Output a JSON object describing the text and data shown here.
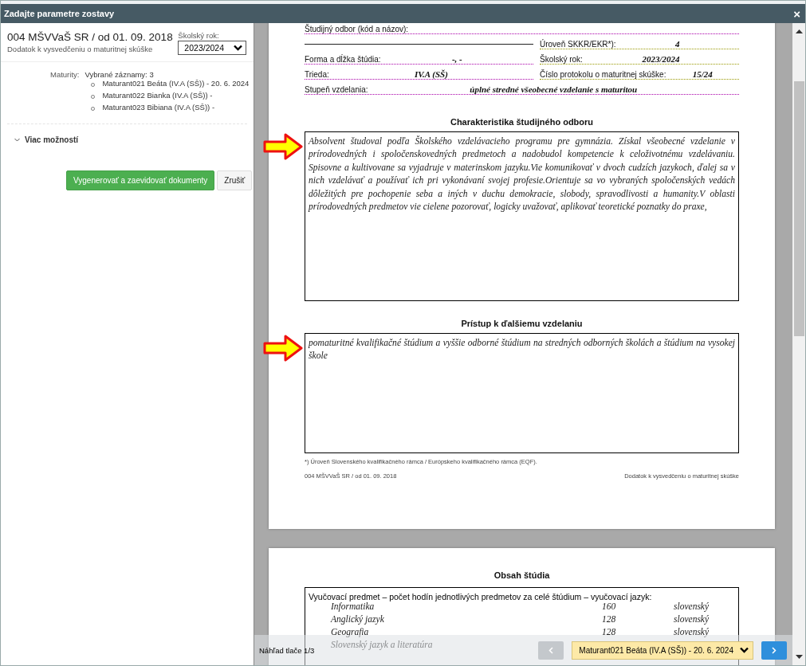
{
  "window": {
    "title": "Zadajte parametre zostavy",
    "close": "×"
  },
  "report": {
    "title": "004 MŠVVaŠ SR / od 01. 09. 2018",
    "subtitle": "Dodatok k vysvedčeniu o maturitnej skúške"
  },
  "school_year": {
    "label": "Školský rok:",
    "value": "2023/2024"
  },
  "selection": {
    "label": "Maturity:",
    "summary": "Vybrané záznamy: 3",
    "items": [
      {
        "text": "Maturant021 Beáta (IV.A (SŠ)) - 20. 6. 2024"
      },
      {
        "text": "Maturant022 Bianka (IV.A (SŠ)) -"
      },
      {
        "text": "Maturant023 Bibiana (IV.A (SŠ)) -"
      }
    ]
  },
  "more_options": {
    "label": "Viac možností",
    "expanded": false
  },
  "buttons": [
    {
      "label": "Vygenerovať a zaevidovať dokumenty",
      "kind": "primary"
    },
    {
      "label": "Zrušiť",
      "kind": "secondary"
    }
  ],
  "preview": {
    "field_rows": [
      {
        "left": {
          "label": "Študijný odbor (kód a názov):"
        }
      },
      {
        "right": {
          "label": "Úroveň SKKR/EKR*):",
          "value": "4"
        }
      },
      {
        "left": {
          "label": "Forma a dĺžka štúdia:",
          "value": "-, -"
        },
        "right": {
          "label": "Školský rok:",
          "value": "2023/2024"
        }
      },
      {
        "left": {
          "label": "Trieda:",
          "value": "IV.A (SŠ)"
        },
        "right": {
          "label": "Číslo protokolu o maturitnej skúške:",
          "value": "15/24"
        }
      },
      {
        "left": {
          "label": "Stupeň vzdelania:",
          "value": "úplné stredné všeobecné vzdelanie s maturitou"
        }
      }
    ],
    "sections": [
      {
        "title": "Charakteristika študijného odboru",
        "text": "Absolvent študoval podľa Školského vzdelávacieho programu pre gymnázia. Získal všeobecné vzdelanie v prírodovedných i spoločenskovedných predmetoch a nadobudol kompetencie k celoživotnému vzdelávaniu. Spisovne a kultivovane sa vyjadruje v materinskom jazyku.Vie komunikovať v dvoch cudzích jazykoch, ďalej sa v nich vzdelávať a používať ich pri vykonávaní svojej profesie.Orientuje sa vo vybraných spoločenských vedách dôležitých pre pochopenie seba a iných v duchu demokracie, slobody, spravodlivosti a humanity.V oblasti prírodovedných predmetov vie cielene pozorovať, logicky uvažovať, aplikovať teoretické poznatky do praxe,",
        "highlighted": true
      },
      {
        "title": "Prístup k ďalšiemu vzdelaniu",
        "text": "pomaturitné kvalifikačné štúdium a vyššie odborné štúdium na stredných odborných školách a štúdium na vysokej škole",
        "highlighted": true
      }
    ],
    "footnote": "*) Úroveň Slovenského kvalifikačného rámca / Európskeho kvalifikačného rámca (EQF).",
    "footer_left": "004 MŠVVaŠ SR / od 01. 09. 2018",
    "footer_right": "Dodatok k vysvedčeniu o maturitnej skúške",
    "page2": {
      "title": "Obsah štúdia",
      "intro": "Vyučovací predmet – počet hodín jednotlivých predmetov za celé štúdium – vyučovací jazyk:",
      "rows": [
        {
          "subject": "Informatika",
          "hours": "160",
          "language": "slovenský"
        },
        {
          "subject": "Anglický jazyk",
          "hours": "128",
          "language": "slovenský"
        },
        {
          "subject": "Geografia",
          "hours": "128",
          "language": "slovenský"
        },
        {
          "subject": "Slovenský jazyk a literatúra"
        }
      ]
    }
  },
  "preview_bar": {
    "page": "Náhľad tlače 1/3",
    "prev_disabled": true,
    "record": "Maturant021 Beáta (IV.A (SŠ)) - 20. 6. 2024",
    "next_disabled": false
  }
}
